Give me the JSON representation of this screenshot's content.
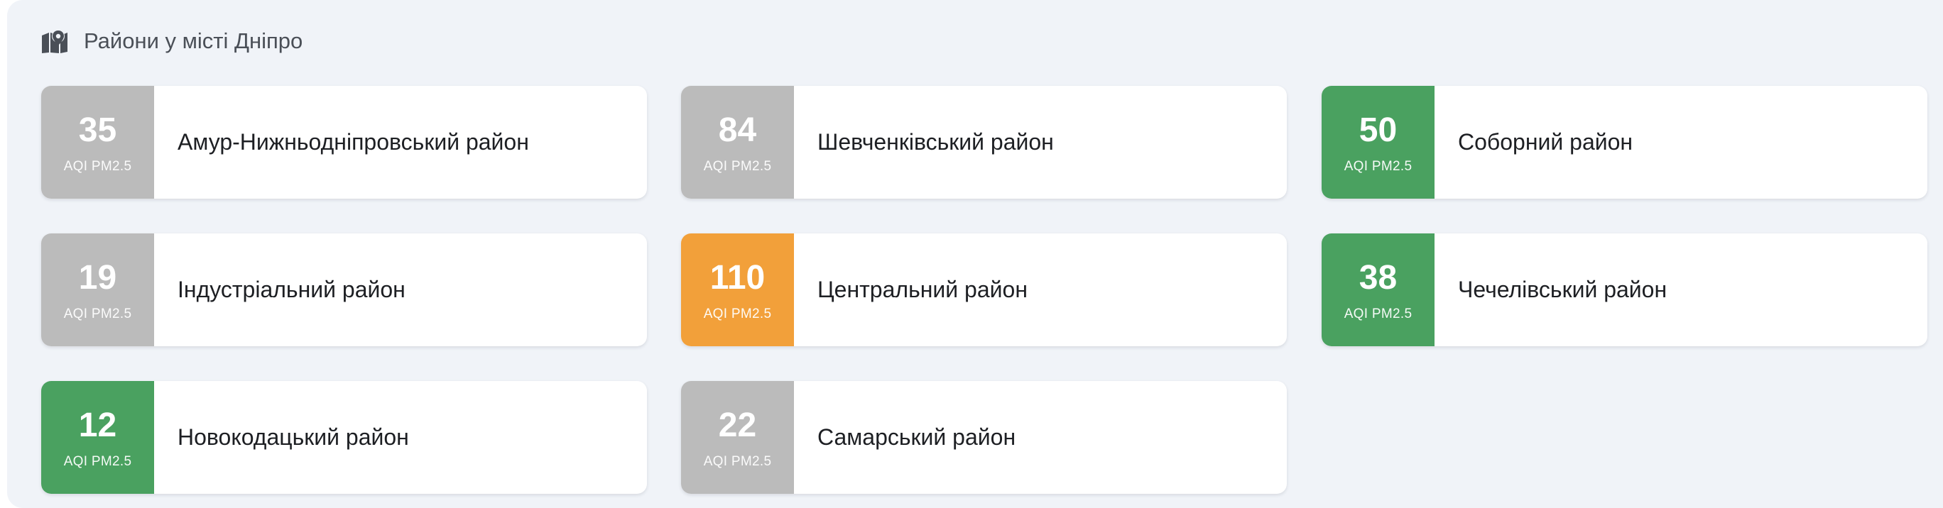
{
  "header": {
    "icon": "map-marker-icon",
    "title": "Райони у місті Дніпро"
  },
  "colors": {
    "panel_bg": "#f0f3f8",
    "gray": "#bbbbbb",
    "green": "#4aa160",
    "orange": "#f2a03a"
  },
  "districts": [
    {
      "aqi": "35",
      "aqi_label": "AQI PM2.5",
      "name": "Амур-Нижньодніпровський район",
      "color": "#bbbbbb"
    },
    {
      "aqi": "84",
      "aqi_label": "AQI PM2.5",
      "name": "Шевченківський район",
      "color": "#bbbbbb"
    },
    {
      "aqi": "50",
      "aqi_label": "AQI PM2.5",
      "name": "Соборний район",
      "color": "#4aa160"
    },
    {
      "aqi": "19",
      "aqi_label": "AQI PM2.5",
      "name": "Індустріальний район",
      "color": "#bbbbbb"
    },
    {
      "aqi": "110",
      "aqi_label": "AQI PM2.5",
      "name": "Центральний район",
      "color": "#f2a03a"
    },
    {
      "aqi": "38",
      "aqi_label": "AQI PM2.5",
      "name": "Чечелівський район",
      "color": "#4aa160"
    },
    {
      "aqi": "12",
      "aqi_label": "AQI PM2.5",
      "name": "Новокодацький район",
      "color": "#4aa160"
    },
    {
      "aqi": "22",
      "aqi_label": "AQI PM2.5",
      "name": "Самарський район",
      "color": "#bbbbbb"
    }
  ]
}
